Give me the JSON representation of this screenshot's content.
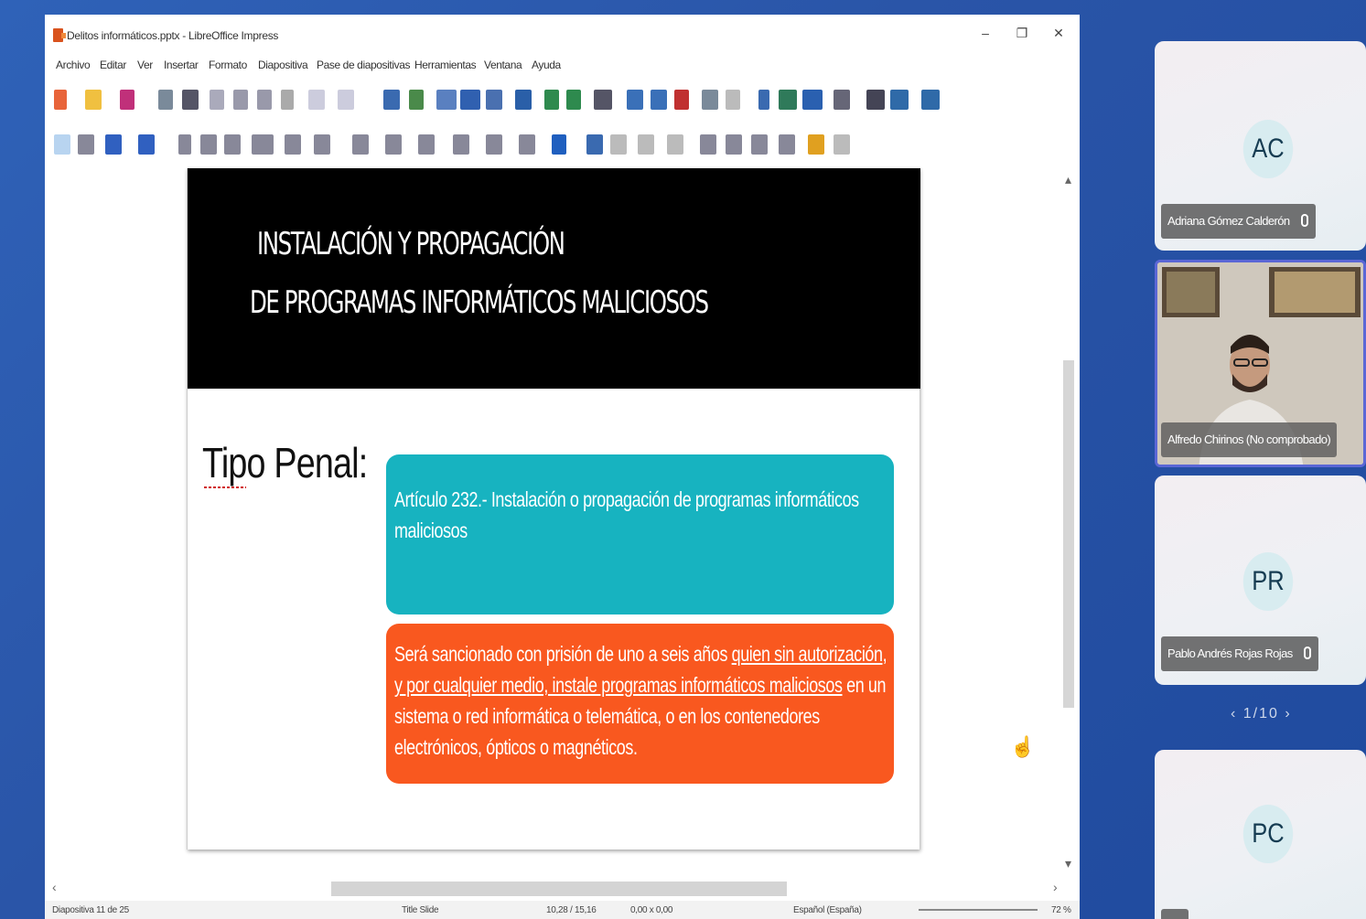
{
  "window": {
    "title": "Delitos informáticos.pptx - LibreOffice Impress",
    "controls": [
      "–",
      "❐",
      "✕"
    ]
  },
  "menubar": {
    "items": [
      "Archivo",
      "Editar",
      "Ver",
      "Insertar",
      "Formato",
      "Diapositiva",
      "Pase de diapositivas",
      "Herramientas",
      "Ventana",
      "Ayuda"
    ]
  },
  "slide": {
    "title_line1": "INSTALACIÓN Y PROPAGACIÓN",
    "title_line2": "DE PROGRAMAS INFORMÁTICOS MALICIOSOS",
    "label": "Tipo Penal:",
    "teal_box_text": "Artículo 232.- Instalación o propagación de programas informáticos maliciosos",
    "orange_box": {
      "part1": "Será sancionado con prisión de uno a seis años ",
      "part2_underlined": "quien sin autorización, y por cualquier medio, instale programas informáticos maliciosos",
      "part3": " en un sistema o red informática o telemática, o en los contenedores electrónicos, ópticos o magnéticos."
    }
  },
  "statusbar": {
    "slide_info": "Diapositiva 11 de 25",
    "layout": "Title Slide",
    "position": "10,28 / 15,16",
    "size": "0,00 x 0,00",
    "language": "Español (España)",
    "zoom": "72 %"
  },
  "participants": [
    {
      "initials": "AC",
      "name": "Adriana Gómez Calderón"
    },
    {
      "initials": "",
      "name": "Alfredo Chirinos (No comprobado)"
    },
    {
      "initials": "PR",
      "name": "Pablo Andrés Rojas Rojas"
    },
    {
      "initials": "PC",
      "name": ""
    }
  ],
  "pager": {
    "text": "1/10"
  },
  "colors": {
    "teal": "#17b3c0",
    "orange": "#f9581f",
    "background_blue": "#2a55a8",
    "active_speaker_border": "#5b67d6"
  }
}
